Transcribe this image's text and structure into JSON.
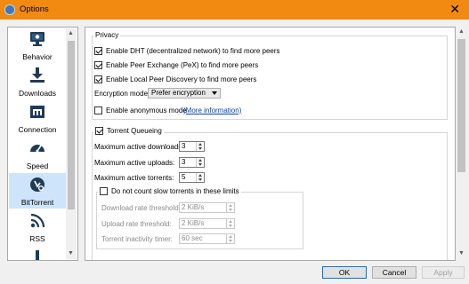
{
  "window": {
    "title": "Options",
    "close_glyph": "✕"
  },
  "sidebar": {
    "items": [
      {
        "label": "Behavior",
        "icon": "monitor-icon"
      },
      {
        "label": "Downloads",
        "icon": "download-icon"
      },
      {
        "label": "Connection",
        "icon": "network-icon"
      },
      {
        "label": "Speed",
        "icon": "speedometer-icon"
      },
      {
        "label": "BitTorrent",
        "icon": "bittorrent-icon",
        "selected": true
      },
      {
        "label": "RSS",
        "icon": "rss-icon"
      }
    ]
  },
  "privacy": {
    "title": "Privacy",
    "dht": {
      "label": "Enable DHT (decentralized network) to find more peers",
      "checked": true
    },
    "pex": {
      "label": "Enable Peer Exchange (PeX) to find more peers",
      "checked": true
    },
    "lpd": {
      "label": "Enable Local Peer Discovery to find more peers",
      "checked": true
    },
    "encryption": {
      "label": "Encryption mode:",
      "value": "Prefer encryption"
    },
    "anonymous": {
      "label": "Enable anonymous mode",
      "checked": false,
      "link": "(More information)"
    }
  },
  "queueing": {
    "title": "Torrent Queueing",
    "checked": true,
    "max_downloads": {
      "label": "Maximum active downloads:",
      "value": "3"
    },
    "max_uploads": {
      "label": "Maximum active uploads:",
      "value": "3"
    },
    "max_torrents": {
      "label": "Maximum active torrents:",
      "value": "5"
    },
    "slow": {
      "label": "Do not count slow torrents in these limits",
      "checked": false,
      "download_rate": {
        "label": "Download rate threshold:",
        "value": "2 KiB/s"
      },
      "upload_rate": {
        "label": "Upload rate threshold:",
        "value": "2 KiB/s"
      },
      "inactivity": {
        "label": "Torrent inactivity timer:",
        "value": "60 sec"
      }
    }
  },
  "buttons": {
    "ok": "OK",
    "cancel": "Cancel",
    "apply": "Apply"
  },
  "colors": {
    "titlebar": "#f28a12",
    "selection": "#cde4fb",
    "link": "#0645ad"
  }
}
